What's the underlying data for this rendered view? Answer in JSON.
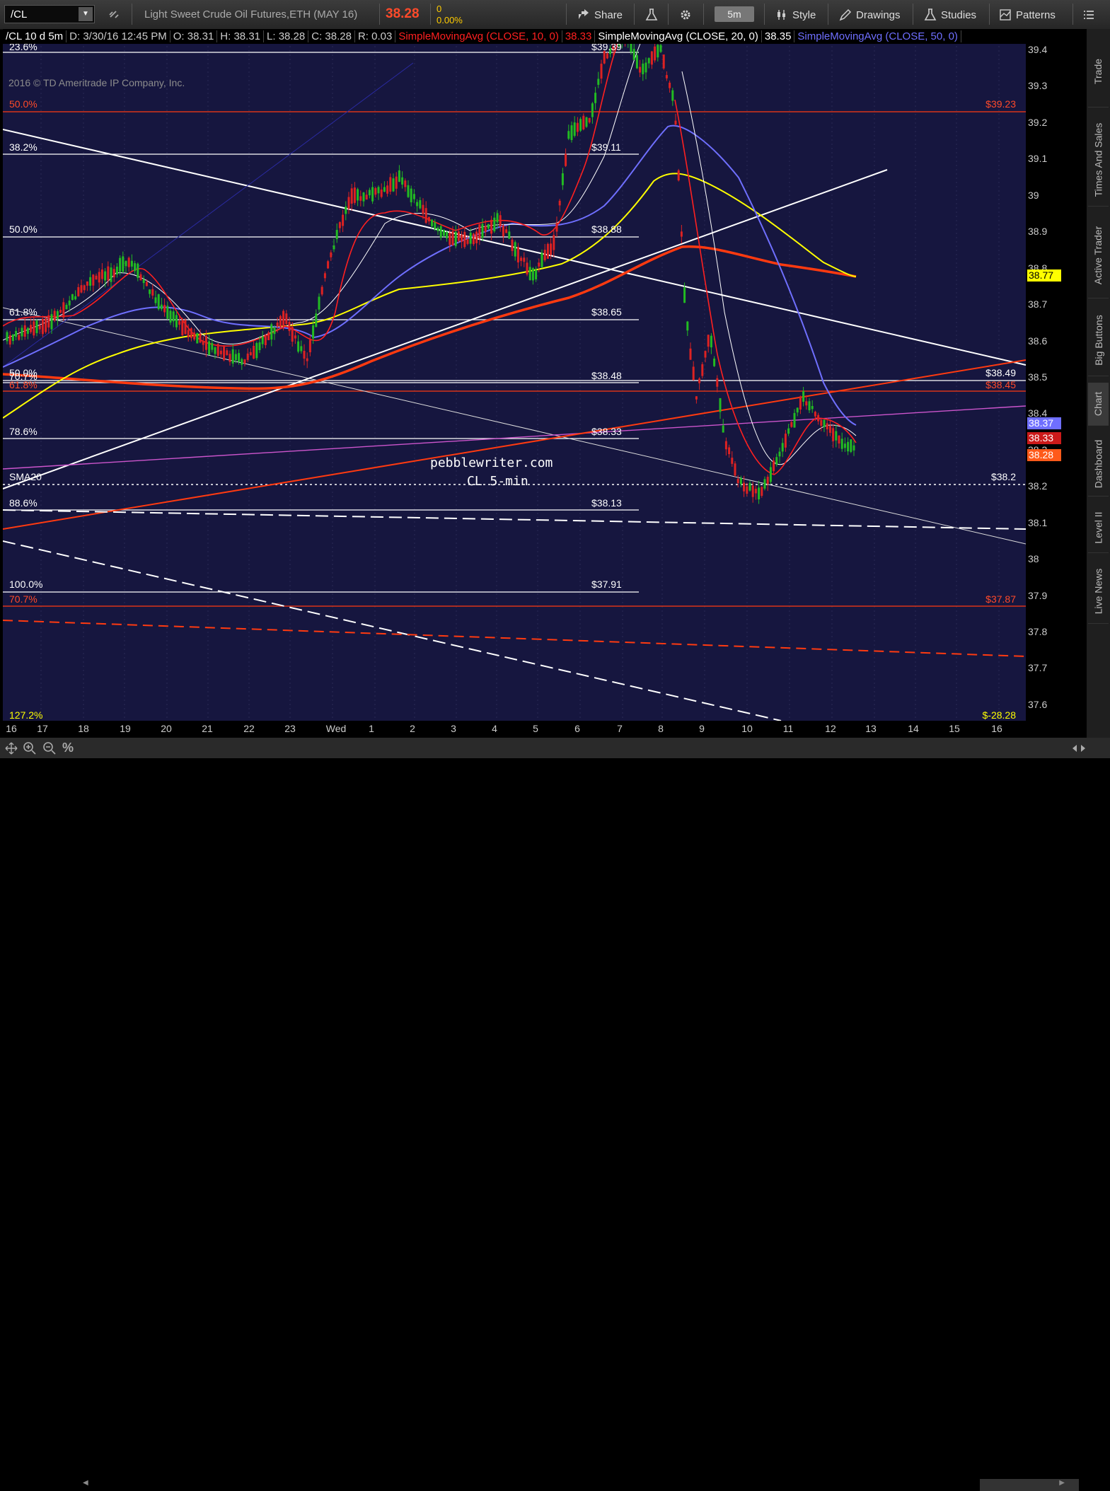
{
  "toolbar": {
    "symbol": "/CL",
    "description": "Light Sweet Crude Oil Futures,ETH (MAY 16)",
    "last_price": "38.28",
    "change": "0",
    "change_pct": "0.00%",
    "share_label": "Share",
    "period": "5m",
    "style_label": "Style",
    "drawings_label": "Drawings",
    "studies_label": "Studies",
    "patterns_label": "Patterns"
  },
  "header": {
    "symbol_period": "/CL 10 d 5m",
    "date": "D: 3/30/16 12:45 PM",
    "open": "O: 38.31",
    "high": "H: 38.31",
    "low": "L: 38.28",
    "close": "C: 38.28",
    "range": "R: 0.03",
    "sma10": "SimpleMovingAvg (CLOSE, 10, 0)",
    "sma10_val": "38.33",
    "sma20": "SimpleMovingAvg (CLOSE, 20, 0)",
    "sma20_val": "38.35",
    "sma50": "SimpleMovingAvg (CLOSE, 50, 0)"
  },
  "copyright": "2016 © TD Ameritrade IP Company, Inc.",
  "watermark": {
    "line1": "pebblewriter.com",
    "line2": "CL 5-min"
  },
  "fib_labels_left": [
    {
      "text": "23.6%",
      "color": "#ffffff"
    },
    {
      "text": "50.0%",
      "color": "#ff4a2a"
    },
    {
      "text": "38.2%",
      "color": "#ffffff"
    },
    {
      "text": "50.0%",
      "color": "#ffffff"
    },
    {
      "text": "61.8%",
      "color": "#ffffff"
    },
    {
      "text": "50.0%",
      "color": "#ffffff"
    },
    {
      "text": "70.7%",
      "color": "#ffffff"
    },
    {
      "text": "61.8%",
      "color": "#ff4a2a"
    },
    {
      "text": "78.6%",
      "color": "#ffffff"
    },
    {
      "text": "SMA20",
      "color": "#ffffff"
    },
    {
      "text": "88.6%",
      "color": "#ffffff"
    },
    {
      "text": "100.0%",
      "color": "#ffffff"
    },
    {
      "text": "70.7%",
      "color": "#ff4a2a"
    },
    {
      "text": "127.2%",
      "color": "#ffff00"
    }
  ],
  "price_points": [
    "$39.39",
    "$39.11",
    "$38.88",
    "$38.65",
    "$38.48",
    "$38.33",
    "$38.13",
    "$37.91"
  ],
  "right_labels": [
    {
      "text": "$39.23",
      "color": "#ff4a2a"
    },
    {
      "text": "$38.49",
      "color": "#ffffff"
    },
    {
      "text": "$38.45",
      "color": "#ff4a2a"
    },
    {
      "text": "$38.2",
      "color": "#ffffff"
    },
    {
      "text": "$37.87",
      "color": "#ff4a2a"
    },
    {
      "text": "$-28.28",
      "color": "#ffff00"
    }
  ],
  "price_axis": [
    "39.4",
    "39.3",
    "39.2",
    "39.1",
    "39",
    "38.9",
    "38.8",
    "38.7",
    "38.6",
    "38.5",
    "38.4",
    "38.3",
    "38.2",
    "38.1",
    "38",
    "37.9",
    "37.8",
    "37.7",
    "37.6"
  ],
  "price_tags": [
    {
      "text": "38.77",
      "bg": "#ffff00",
      "fg": "#000000"
    },
    {
      "text": "38.37",
      "bg": "#6f6fff",
      "fg": "#ffffff"
    },
    {
      "text": "38.33",
      "bg": "#cc1a1a",
      "fg": "#ffffff"
    },
    {
      "text": "38.28",
      "bg": "#ff5a1a",
      "fg": "#ffffff"
    }
  ],
  "time_axis": [
    "16",
    "17",
    "18",
    "19",
    "20",
    "21",
    "22",
    "23",
    "Wed",
    "1",
    "2",
    "3",
    "4",
    "5",
    "6",
    "7",
    "8",
    "9",
    "10",
    "11",
    "12",
    "13",
    "14",
    "15",
    "16"
  ],
  "side_tabs": [
    "Trade",
    "Times And Sales",
    "Active Trader",
    "Big Buttons",
    "Chart",
    "Dashboard",
    "Level II",
    "Live News"
  ],
  "colors": {
    "chart_bg": "#16163f",
    "sma10": "#ff2020",
    "sma20": "#ffffff",
    "sma50": "#6f6fff",
    "sma_yellow": "#ffff00",
    "sma_orange": "#ff3a10",
    "up_candle": "#22bb22",
    "down_candle": "#dd2222"
  }
}
